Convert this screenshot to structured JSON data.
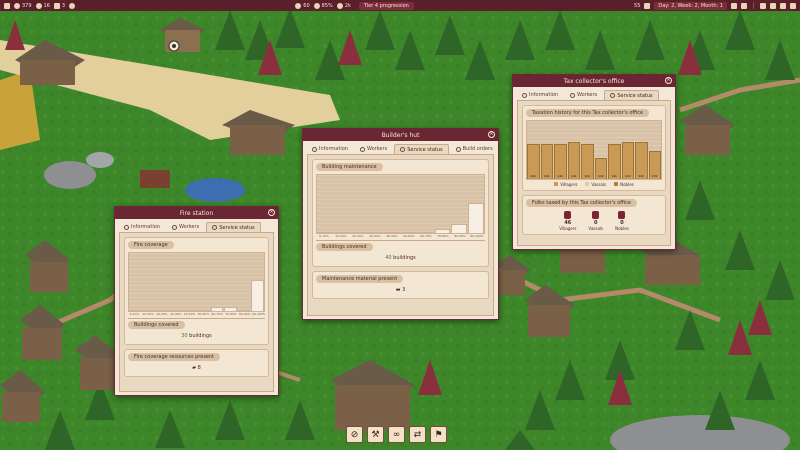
{
  "topbar": {
    "money": "379",
    "workers": "16",
    "slot_a": "3",
    "pop_a": "60",
    "happiness": "85%",
    "pop_b": "2k",
    "tier": "Tier 4 progression",
    "speed": "55",
    "date": "Day: 2, Week: 2, Month: 1",
    "colors": {
      "bar": "#5a1f2b",
      "accent": "#7a2e3a"
    }
  },
  "fire_station": {
    "title": "Fire station",
    "tabs": [
      "Information",
      "Workers",
      "Service status"
    ],
    "active_tab": 2,
    "coverage_label": "Fire coverage",
    "chart_data": {
      "type": "bar",
      "categories": [
        "0-10%",
        "10-20%",
        "20-30%",
        "30-40%",
        "40-50%",
        "50-60%",
        "60-70%",
        "70-80%",
        "80-90%",
        "90-100%"
      ],
      "values": [
        0,
        0,
        0,
        0,
        0,
        0,
        3,
        3,
        0,
        22
      ],
      "ylim": [
        0,
        40
      ]
    },
    "buildings_label": "Buildings covered",
    "buildings_count": "30",
    "buildings_unit": "buildings",
    "resources_label": "Fire coverage resources present",
    "resources_count": "8"
  },
  "builders_hut": {
    "title": "Builder's hut",
    "tabs": [
      "Information",
      "Workers",
      "Service status",
      "Build orders"
    ],
    "active_tab": 2,
    "maintenance_label": "Building maintenance",
    "chart_data": {
      "type": "bar",
      "categories": [
        "0-10%",
        "10-20%",
        "20-30%",
        "30-40%",
        "40-50%",
        "50-60%",
        "60-70%",
        "70-80%",
        "80-90%",
        "90-100%"
      ],
      "values": [
        0,
        0,
        0,
        0,
        0,
        0,
        0,
        2,
        5,
        16
      ],
      "ylim": [
        0,
        30
      ]
    },
    "buildings_label": "Buildings covered",
    "buildings_count": "40",
    "buildings_unit": "buildings",
    "material_label": "Maintenance material present",
    "material_count": "3"
  },
  "tax_office": {
    "title": "Tax collector's office",
    "tabs": [
      "Information",
      "Workers",
      "Service status"
    ],
    "active_tab": 2,
    "history_label": "Taxation history for this Tax collector's office",
    "chart_data": {
      "type": "bar",
      "categories": [
        "1",
        "2",
        "3",
        "4",
        "5",
        "6",
        "7",
        "8",
        "9",
        "10"
      ],
      "series": [
        {
          "name": "Villagers",
          "values": [
            38,
            38,
            38,
            40,
            38,
            22,
            38,
            40,
            40,
            30
          ]
        }
      ],
      "bar_labels": [
        "$4k",
        "$4k",
        "$4k",
        "$4k",
        "$4k",
        "$2k",
        "$4k",
        "$4k",
        "$4k",
        "$3k"
      ],
      "ylim": [
        0,
        60
      ]
    },
    "legend": [
      "Villagers",
      "Vassals",
      "Nobles"
    ],
    "legend_colors": [
      "#c89a55",
      "#e6cc9c",
      "#b08040"
    ],
    "folks_label": "Folks taxed by this Tax collector's office",
    "folks": [
      {
        "count": "46",
        "label": "Villagers"
      },
      {
        "count": "0",
        "label": "Vassals"
      },
      {
        "count": "0",
        "label": "Nobles"
      }
    ]
  },
  "actions": [
    "demolish-icon",
    "pickaxe-icon",
    "binoculars-icon",
    "relocate-icon",
    "flag-icon"
  ]
}
